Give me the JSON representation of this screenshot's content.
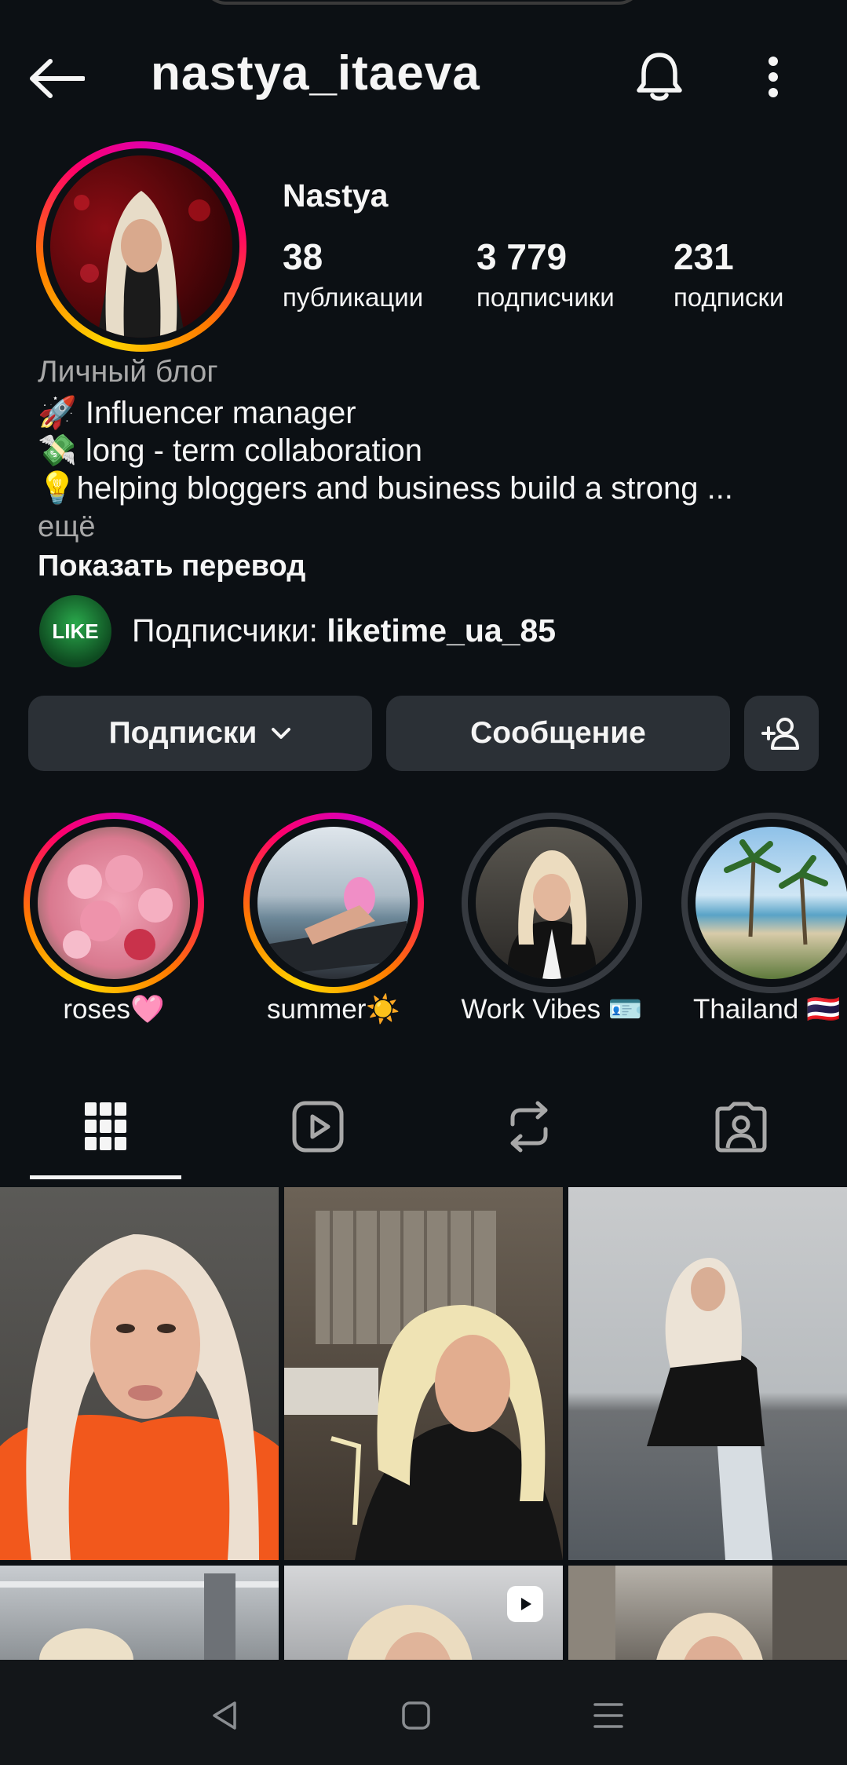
{
  "header": {
    "username": "nastya_itaeva",
    "icons": [
      "back-arrow-icon",
      "bell-icon",
      "more-vertical-icon"
    ]
  },
  "profile": {
    "display_name": "Nastya",
    "stats": [
      {
        "value": "38",
        "label": "публикации"
      },
      {
        "value": "3 779",
        "label": "подписчики"
      },
      {
        "value": "231",
        "label": "подписки"
      }
    ],
    "category": "Личный блог",
    "bio": [
      "🚀 Influencer manager",
      "💸 long - term collaboration",
      "💡helping bloggers and business build a strong ..."
    ],
    "more_label": "ещё",
    "translate_label": "Показать перевод",
    "followers_prefix": "Подписчики: ",
    "followers_account": "liketime_ua_85",
    "follower_avatar_text": "LIKE"
  },
  "actions": {
    "following_label": "Подписки",
    "message_label": "Сообщение"
  },
  "highlights": [
    {
      "label": "roses🩷"
    },
    {
      "label": "summer☀️"
    },
    {
      "label": "Work Vibes 🪪"
    },
    {
      "label": "Thailand 🇹🇭"
    }
  ],
  "tabs": [
    "grid-icon",
    "reels-icon",
    "reposts-icon",
    "tagged-icon"
  ],
  "colors": {
    "background": "#0c1014",
    "button": "#2b3036",
    "secondary_text": "#a8a8a8"
  }
}
